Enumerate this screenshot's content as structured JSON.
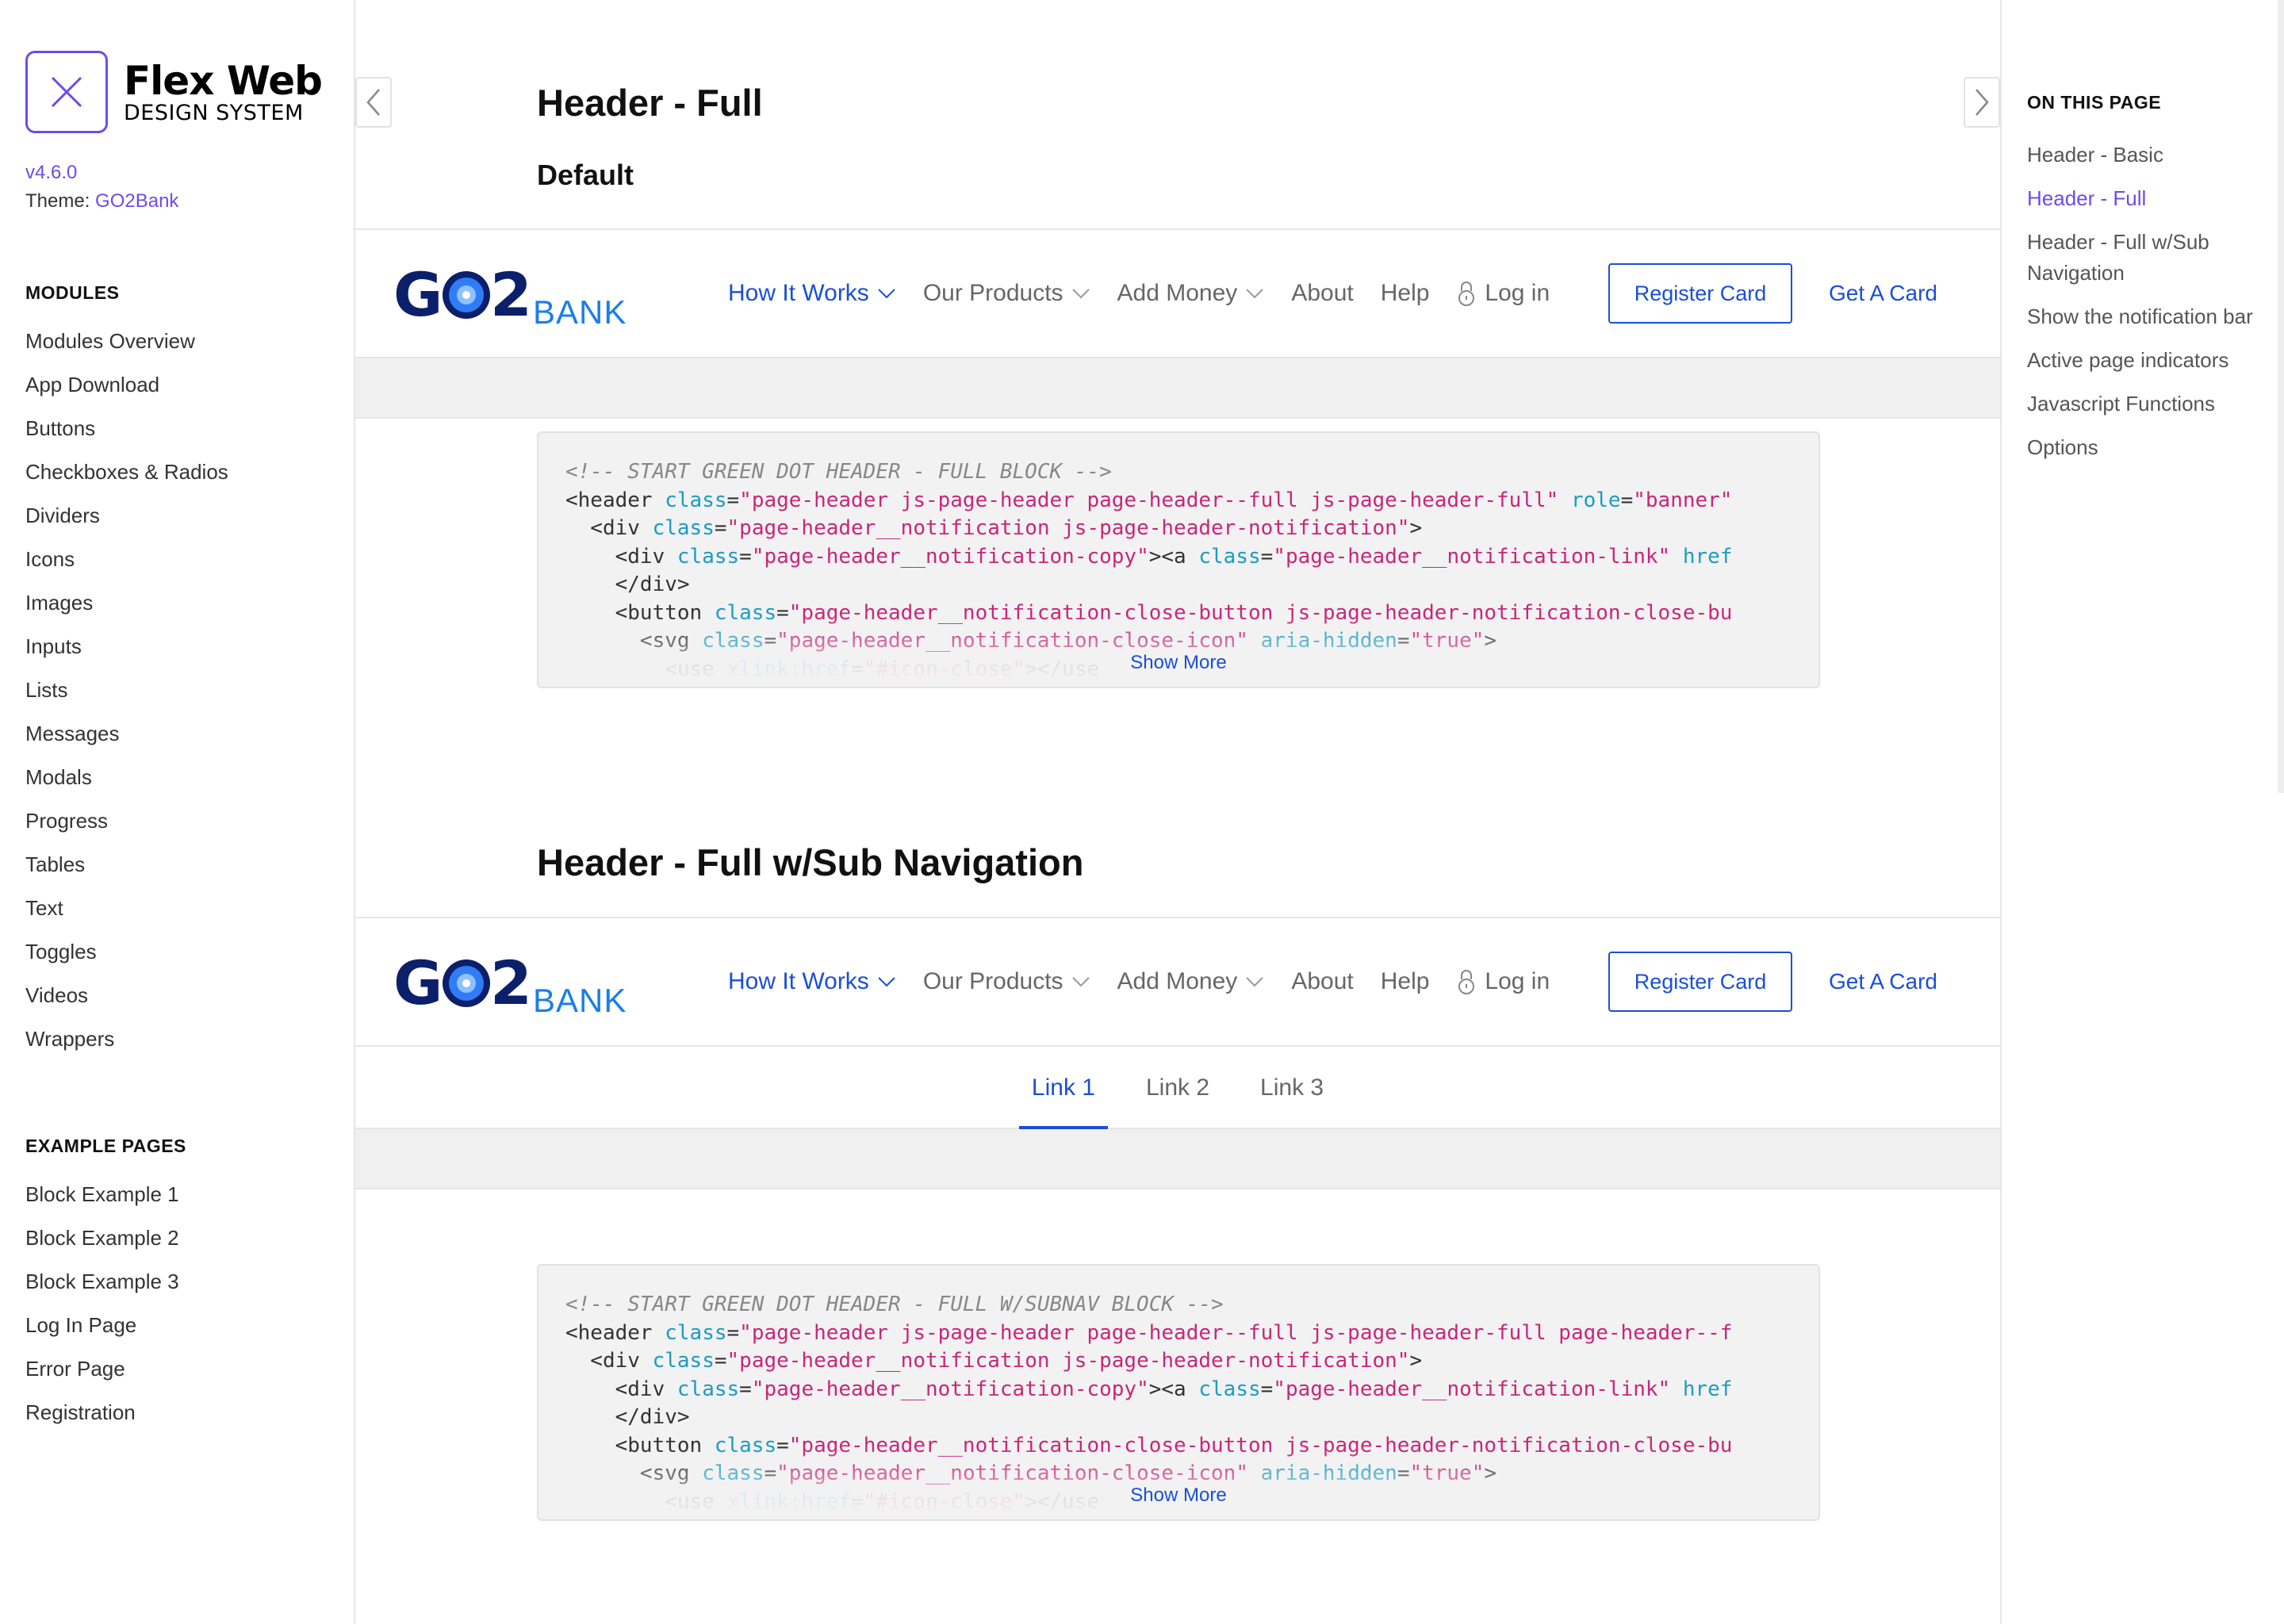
{
  "sidebar": {
    "brand_name": "Flex Web",
    "brand_sub": "DESIGN SYSTEM",
    "version": "v4.6.0",
    "theme_label": "Theme:",
    "theme_value": "GO2Bank",
    "modules_heading": "MODULES",
    "modules": [
      "Modules Overview",
      "App Download",
      "Buttons",
      "Checkboxes & Radios",
      "Dividers",
      "Icons",
      "Images",
      "Inputs",
      "Lists",
      "Messages",
      "Modals",
      "Progress",
      "Tables",
      "Text",
      "Toggles",
      "Videos",
      "Wrappers"
    ],
    "examples_heading": "EXAMPLE PAGES",
    "examples": [
      "Block Example 1",
      "Block Example 2",
      "Block Example 3",
      "Log In Page",
      "Error Page",
      "Registration"
    ]
  },
  "main": {
    "title": "Header - Full",
    "subtitle": "Default",
    "section2_title": "Header - Full w/Sub Navigation",
    "show_more": "Show More"
  },
  "demo_header": {
    "logo_go": "GO2",
    "logo_bank": "BANK",
    "menu": [
      {
        "label": "How It Works",
        "dropdown": true,
        "active": true
      },
      {
        "label": "Our Products",
        "dropdown": true,
        "active": false
      },
      {
        "label": "Add Money",
        "dropdown": true,
        "active": false
      },
      {
        "label": "About",
        "dropdown": false,
        "active": false
      },
      {
        "label": "Help",
        "dropdown": false,
        "active": false
      }
    ],
    "login": "Log in",
    "register": "Register Card",
    "get_card": "Get A Card"
  },
  "subnav": {
    "links": [
      "Link 1",
      "Link 2",
      "Link 3"
    ],
    "active_index": 0
  },
  "code_blocks": [
    {
      "comment": "<!-- START GREEN DOT HEADER - FULL BLOCK -->",
      "lines": [
        {
          "indent": 0,
          "tag": "<header",
          "attr": "class",
          "val": "\"page-header js-page-header page-header--full js-page-header-full\"",
          "attr2": "role",
          "val2": "\"banner\""
        },
        {
          "indent": 2,
          "tag": "<div",
          "attr": "class",
          "val": "\"page-header__notification js-page-header-notification\"",
          "tail": ">"
        },
        {
          "indent": 4,
          "tag": "<div",
          "attr": "class",
          "val": "\"page-header__notification-copy\"",
          "tail": "><a ",
          "attr2": "class",
          "val2": "\"page-header__notification-link\"",
          "attr3": "href"
        },
        {
          "indent": 4,
          "tag": "</div>"
        },
        {
          "indent": 4,
          "tag": "<button",
          "attr": "class",
          "val": "\"page-header__notification-close-button js-page-header-notification-close-bu"
        },
        {
          "indent": 6,
          "tag": "<svg",
          "attr": "class",
          "val": "\"page-header__notification-close-icon\"",
          "attr2": "aria-hidden",
          "val2": "\"true\"",
          "tail2": ">"
        },
        {
          "indent": 8,
          "tag": "<use",
          "attr": "xlink:href",
          "val": "\"#icon-close\"",
          "tail": "></use",
          "fade": true
        }
      ]
    },
    {
      "comment": "<!-- START GREEN DOT HEADER - FULL W/SUBNAV BLOCK -->",
      "lines": [
        {
          "indent": 0,
          "tag": "<header",
          "attr": "class",
          "val": "\"page-header js-page-header page-header--full js-page-header-full page-header--f"
        },
        {
          "indent": 2,
          "tag": "<div",
          "attr": "class",
          "val": "\"page-header__notification js-page-header-notification\"",
          "tail": ">"
        },
        {
          "indent": 4,
          "tag": "<div",
          "attr": "class",
          "val": "\"page-header__notification-copy\"",
          "tail": "><a ",
          "attr2": "class",
          "val2": "\"page-header__notification-link\"",
          "attr3": "href"
        },
        {
          "indent": 4,
          "tag": "</div>"
        },
        {
          "indent": 4,
          "tag": "<button",
          "attr": "class",
          "val": "\"page-header__notification-close-button js-page-header-notification-close-bu"
        },
        {
          "indent": 6,
          "tag": "<svg",
          "attr": "class",
          "val": "\"page-header__notification-close-icon\"",
          "attr2": "aria-hidden",
          "val2": "\"true\"",
          "tail2": ">"
        },
        {
          "indent": 8,
          "tag": "<use",
          "attr": "xlink:href",
          "val": "\"#icon-close\"",
          "tail": "></use",
          "fade": true
        }
      ]
    }
  ],
  "toc": {
    "heading": "ON THIS PAGE",
    "items": [
      "Header - Basic",
      "Header - Full",
      "Header - Full w/Sub Navigation",
      "Show the notification bar",
      "Active page indicators",
      "Javascript Functions",
      "Options"
    ],
    "active_index": 1
  },
  "colors": {
    "brand_purple": "#6e4ce6",
    "bank_blue": "#1a4fd6",
    "logo_navy": "#0b1f6b",
    "code_attr": "#1c9bc4",
    "code_string": "#c8267a"
  },
  "icons": [
    "close-x-icon",
    "chevron-left-icon",
    "chevron-right-icon",
    "chevron-down-icon",
    "lock-icon"
  ]
}
